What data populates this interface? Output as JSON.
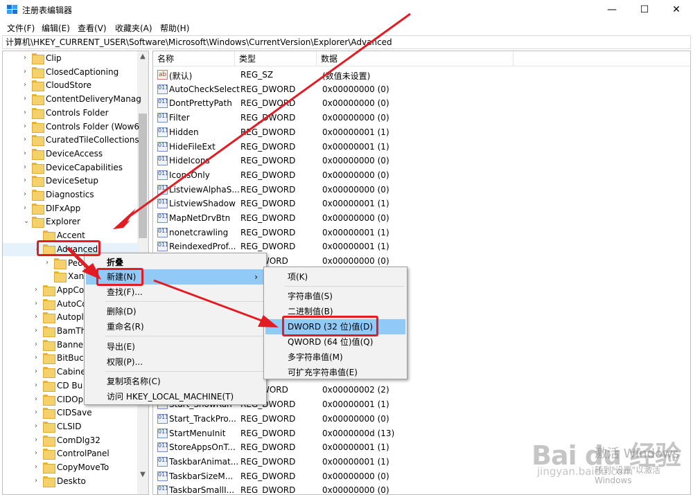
{
  "window": {
    "title": "注册表编辑器",
    "minimize": "—",
    "maximize": "☐",
    "close": "✕"
  },
  "menu": [
    "文件(F)",
    "编辑(E)",
    "查看(V)",
    "收藏夹(A)",
    "帮助(H)"
  ],
  "address": "计算机\\HKEY_CURRENT_USER\\Software\\Microsoft\\Windows\\CurrentVersion\\Explorer\\Advanced",
  "tree": [
    {
      "label": "Clip",
      "chev": "›"
    },
    {
      "label": "ClosedCaptioning",
      "chev": "›"
    },
    {
      "label": "CloudStore",
      "chev": "›"
    },
    {
      "label": "ContentDeliveryManag",
      "chev": "›"
    },
    {
      "label": "Controls Folder",
      "chev": "›"
    },
    {
      "label": "Controls Folder (Wow6",
      "chev": "›"
    },
    {
      "label": "CuratedTileCollections",
      "chev": "›"
    },
    {
      "label": "DeviceAccess",
      "chev": "›"
    },
    {
      "label": "DeviceCapabilities",
      "chev": "›"
    },
    {
      "label": "DeviceSetup",
      "chev": "›"
    },
    {
      "label": "Diagnostics",
      "chev": "›"
    },
    {
      "label": "DIFxApp",
      "chev": "›"
    },
    {
      "label": "Explorer",
      "chev": "⌄"
    },
    {
      "label": "Accent",
      "chev": ""
    },
    {
      "label": "Advanced",
      "chev": "⌄"
    },
    {
      "label": "Peo",
      "chev": "›"
    },
    {
      "label": "Xan",
      "chev": ""
    },
    {
      "label": "AppCo",
      "chev": "›"
    },
    {
      "label": "AutoCo",
      "chev": "›"
    },
    {
      "label": "Autopl",
      "chev": "›"
    },
    {
      "label": "BamTh",
      "chev": "›"
    },
    {
      "label": "Banne",
      "chev": "›"
    },
    {
      "label": "BitBuc",
      "chev": "›"
    },
    {
      "label": "Cabine",
      "chev": "›"
    },
    {
      "label": "CD Bu",
      "chev": "›"
    },
    {
      "label": "CIDOp",
      "chev": "›"
    },
    {
      "label": "CIDSave",
      "chev": "›"
    },
    {
      "label": "CLSID",
      "chev": "›"
    },
    {
      "label": "ComDlg32",
      "chev": "›"
    },
    {
      "label": "ControlPanel",
      "chev": "›"
    },
    {
      "label": "CopyMoveTo",
      "chev": "›"
    },
    {
      "label": "Deskto",
      "chev": "›"
    }
  ],
  "list": {
    "headers": [
      "名称",
      "类型",
      "数据"
    ],
    "rows": [
      {
        "name": "(默认)",
        "type": "REG_SZ",
        "data": "(数值未设置)",
        "icon": "ab"
      },
      {
        "name": "AutoCheckSelect",
        "type": "REG_DWORD",
        "data": "0x00000000 (0)",
        "icon": "dword"
      },
      {
        "name": "DontPrettyPath",
        "type": "REG_DWORD",
        "data": "0x00000000 (0)",
        "icon": "dword"
      },
      {
        "name": "Filter",
        "type": "REG_DWORD",
        "data": "0x00000000 (0)",
        "icon": "dword"
      },
      {
        "name": "Hidden",
        "type": "REG_DWORD",
        "data": "0x00000001 (1)",
        "icon": "dword"
      },
      {
        "name": "HideFileExt",
        "type": "REG_DWORD",
        "data": "0x00000001 (1)",
        "icon": "dword"
      },
      {
        "name": "HideIcons",
        "type": "REG_DWORD",
        "data": "0x00000000 (0)",
        "icon": "dword"
      },
      {
        "name": "IconsOnly",
        "type": "REG_DWORD",
        "data": "0x00000000 (0)",
        "icon": "dword"
      },
      {
        "name": "ListviewAlphaS...",
        "type": "REG_DWORD",
        "data": "0x00000000 (0)",
        "icon": "dword"
      },
      {
        "name": "ListviewShadow",
        "type": "REG_DWORD",
        "data": "0x00000001 (1)",
        "icon": "dword"
      },
      {
        "name": "MapNetDrvBtn",
        "type": "REG_DWORD",
        "data": "0x00000000 (0)",
        "icon": "dword"
      },
      {
        "name": "nonetcrawling",
        "type": "REG_DWORD",
        "data": "0x00000001 (1)",
        "icon": "dword"
      },
      {
        "name": "ReindexedProf...",
        "type": "REG_DWORD",
        "data": "0x00000001 (1)",
        "icon": "dword"
      },
      {
        "name": "",
        "type": "WORD",
        "data": "0x00000000 (0)",
        "icon": "dword"
      },
      {
        "name": "",
        "type": "",
        "data": "",
        "icon": "none"
      },
      {
        "name": "",
        "type": "",
        "data": "",
        "icon": "none"
      },
      {
        "name": "",
        "type": "",
        "data": "",
        "icon": "none"
      },
      {
        "name": "",
        "type": "",
        "data": "",
        "icon": "none"
      },
      {
        "name": "",
        "type": "",
        "data": "",
        "icon": "none"
      },
      {
        "name": "",
        "type": "",
        "data": "",
        "icon": "none"
      },
      {
        "name": "",
        "type": "",
        "data": "",
        "icon": "none"
      },
      {
        "name": "",
        "type": "",
        "data": "",
        "icon": "none"
      },
      {
        "name": "",
        "type": "WORD",
        "data": "0x00000002 (2)",
        "icon": "dword"
      },
      {
        "name": "Start_ShowRun",
        "type": "REG_DWORD",
        "data": "0x00000001 (1)",
        "icon": "dword"
      },
      {
        "name": "Start_TrackPro...",
        "type": "REG_DWORD",
        "data": "0x00000000 (0)",
        "icon": "dword"
      },
      {
        "name": "StartMenuInit",
        "type": "REG_DWORD",
        "data": "0x0000000d (13)",
        "icon": "dword"
      },
      {
        "name": "StoreAppsOnT...",
        "type": "REG_DWORD",
        "data": "0x00000001 (1)",
        "icon": "dword"
      },
      {
        "name": "TaskbarAnimat...",
        "type": "REG_DWORD",
        "data": "0x00000001 (1)",
        "icon": "dword"
      },
      {
        "name": "TaskbarSizeM...",
        "type": "REG_DWORD",
        "data": "0x00000000 (0)",
        "icon": "dword"
      },
      {
        "name": "TaskbarSmallI...",
        "type": "REG_DWORD",
        "data": "0x00000000 (0)",
        "icon": "dword"
      }
    ]
  },
  "context_menu": {
    "items": [
      {
        "label": "折叠",
        "bold": true
      },
      {
        "label": "新建(N)",
        "submenu_arrow": "›"
      },
      {
        "label": "查找(F)..."
      },
      {
        "label": "删除(D)"
      },
      {
        "label": "重命名(R)"
      },
      {
        "label": "导出(E)"
      },
      {
        "label": "权限(P)..."
      },
      {
        "label": "复制项名称(C)"
      },
      {
        "label": "访问 HKEY_LOCAL_MACHINE(T)"
      }
    ]
  },
  "submenu": {
    "items": [
      {
        "label": "项(K)"
      },
      {
        "label": "字符串值(S)"
      },
      {
        "label": "二进制值(B)"
      },
      {
        "label": "DWORD (32 位)值(D)"
      },
      {
        "label": "QWORD (64 位)值(Q)"
      },
      {
        "label": "多字符串值(M)"
      },
      {
        "label": "可扩充字符串值(E)"
      }
    ]
  },
  "watermark": {
    "brand": "Bai du 经验",
    "url": "jingyan.baidu.com",
    "activate_1": "激活 Windows",
    "activate_2": "转到\"设置\"以激活 Windows"
  },
  "colors": {
    "highlight": "#91c9f7",
    "annotation_red": "#e31b23",
    "folder": "#f5d16b"
  }
}
